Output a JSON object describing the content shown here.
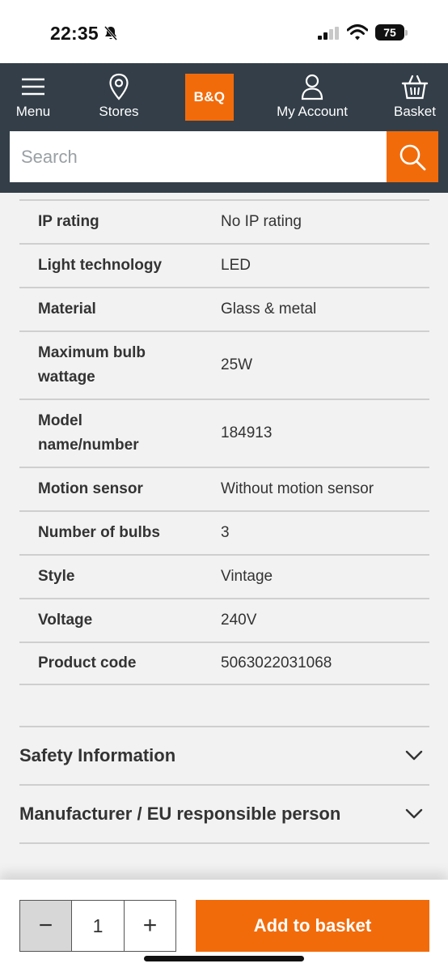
{
  "status_bar": {
    "time": "22:35",
    "battery": "75",
    "icons": [
      "bell-slash-icon",
      "signal-icon",
      "wifi-icon",
      "battery-icon"
    ]
  },
  "header": {
    "nav": {
      "menu": "Menu",
      "stores": "Stores",
      "account": "My Account",
      "basket": "Basket"
    },
    "logo": "B&Q",
    "search_placeholder": "Search",
    "brand_color": "#f26b0b",
    "header_color": "#333e48"
  },
  "specs": [
    {
      "name": "IP rating",
      "value": "No IP rating"
    },
    {
      "name": "Light technology",
      "value": "LED"
    },
    {
      "name": "Material",
      "value": "Glass & metal"
    },
    {
      "name": "Maximum bulb wattage",
      "value": "25W"
    },
    {
      "name": "Model name/number",
      "value": "184913"
    },
    {
      "name": "Motion sensor",
      "value": "Without motion sensor"
    },
    {
      "name": "Number of bulbs",
      "value": "3"
    },
    {
      "name": "Style",
      "value": "Vintage"
    },
    {
      "name": "Voltage",
      "value": "240V"
    },
    {
      "name": "Product code",
      "value": "5063022031068"
    }
  ],
  "accordions": {
    "safety": "Safety Information",
    "manufacturer": "Manufacturer / EU responsible person"
  },
  "basket_bar": {
    "quantity": "1",
    "minus": "−",
    "plus": "+",
    "add_label": "Add to basket"
  }
}
